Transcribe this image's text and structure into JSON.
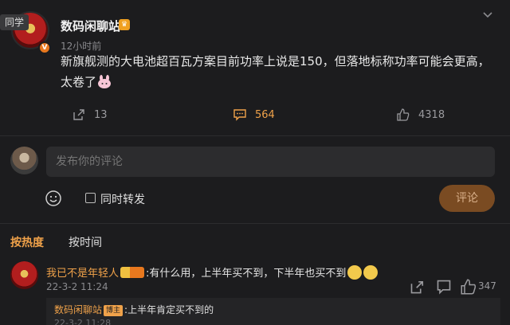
{
  "post": {
    "author": "数码闲聊站",
    "fans_tag": "同学",
    "verified_label": "V",
    "time": "12小时前",
    "text": "新旗舰测的大电池超百瓦方案目前功率上说是150，但落地标称功率可能会更高，太卷了",
    "actions": {
      "repost_count": "13",
      "comment_count": "564",
      "like_count": "4318"
    }
  },
  "composer": {
    "placeholder": "发布你的评论",
    "repost_label": "同时转发",
    "submit_label": "评论"
  },
  "sort": {
    "hot_label": "按热度",
    "time_label": "按时间"
  },
  "comments": [
    {
      "user": "我已不是年轻人",
      "text": ":有什么用，上半年买不到，下半年也买不到",
      "time": "22-3-2 11:24",
      "like_count": "347",
      "reply": {
        "user": "数码闲聊站",
        "badge": "博主",
        "text": ":上半年肯定买不到的",
        "time": "22-3-2 11:28"
      }
    }
  ],
  "colors": {
    "background": "#1c1c1e",
    "accent": "#f0a24a",
    "submit_bg": "#7a4b22"
  }
}
